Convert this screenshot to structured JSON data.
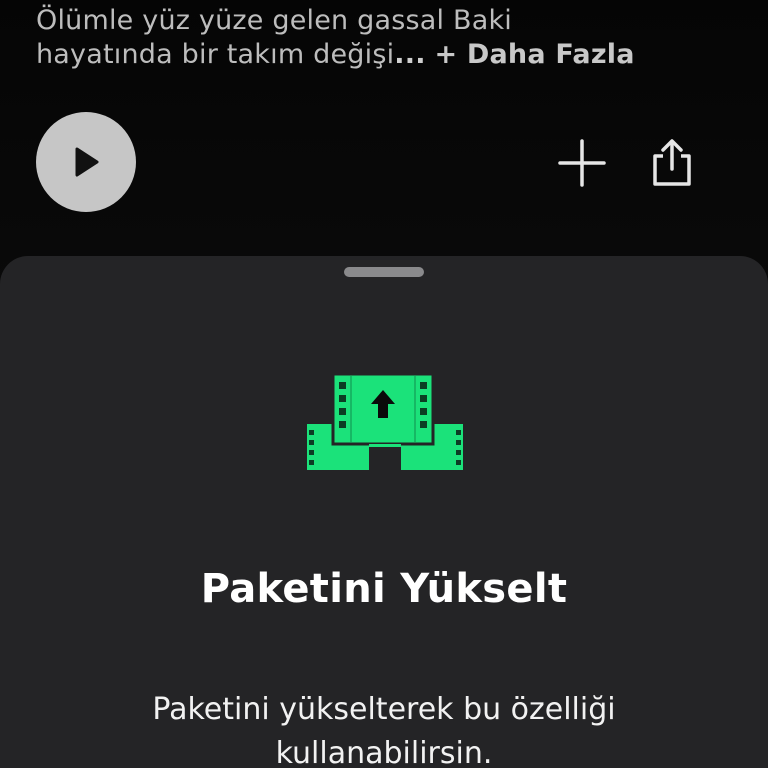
{
  "episode": {
    "description_line1": "Ölümle yüz yüze gelen gassal Baki",
    "description_line2": "hayatında bir takım değişi",
    "ellipsis": "...",
    "more_label": "+ Daha Fazla"
  },
  "actions": {
    "play_icon": "play-icon",
    "add_icon": "plus-icon",
    "share_icon": "share-icon"
  },
  "sheet": {
    "illustration_icon": "film-upload-icon",
    "title": "Paketini Yükselt",
    "body": "Paketini yükselterek bu özelliği kullanabilirsin."
  },
  "colors": {
    "accent_green": "#1BE27A",
    "sheet_background": "#242426",
    "play_button": "#C6C6C6"
  }
}
